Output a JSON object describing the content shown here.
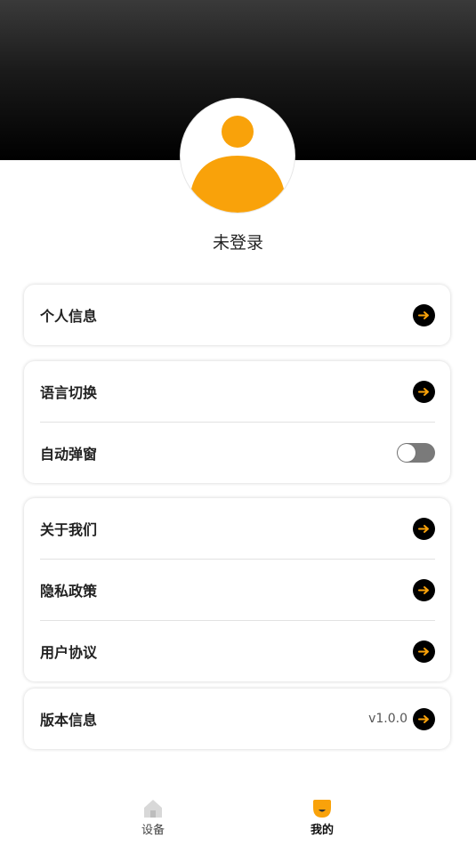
{
  "profile": {
    "username": "未登录"
  },
  "menu": {
    "personal_info": "个人信息",
    "language_switch": "语言切换",
    "auto_popup": "自动弹窗",
    "about_us": "关于我们",
    "privacy_policy": "隐私政策",
    "user_agreement": "用户协议",
    "version_info": "版本信息",
    "version_value": "v1.0.0"
  },
  "auto_popup_enabled": false,
  "tabs": {
    "device": "设备",
    "mine": "我的",
    "active": "mine"
  },
  "colors": {
    "accent": "#F9A20A",
    "header_dark": "#000000",
    "toggle_off": "#7A7A7A"
  },
  "icons": {
    "avatar": "user-avatar-icon",
    "row_arrow": "arrow-right-circle-icon",
    "device_tab": "home-icon",
    "mine_tab": "mine-face-icon"
  }
}
